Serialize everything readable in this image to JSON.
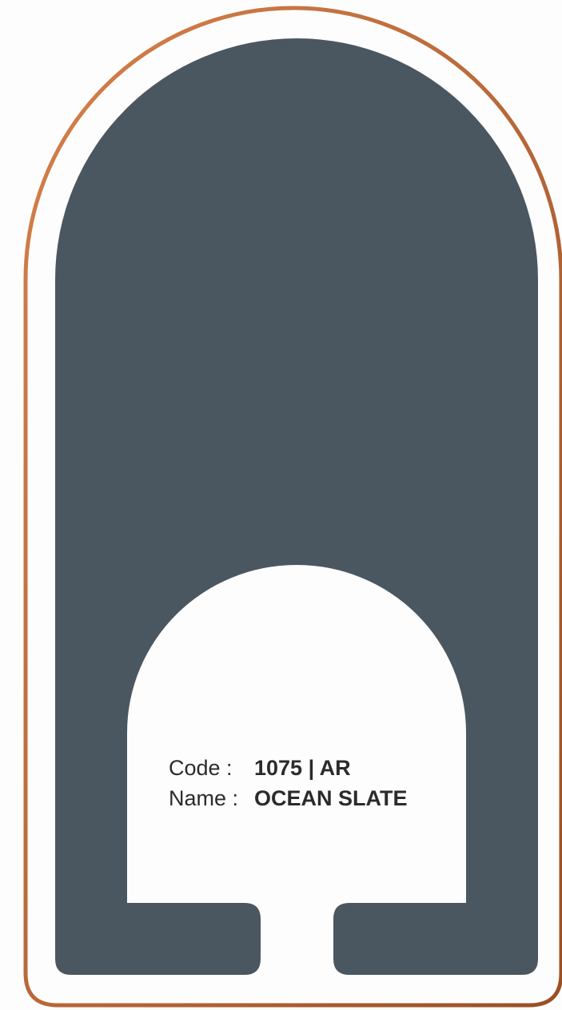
{
  "swatch": {
    "code_label": "Code :",
    "code_value": "1075 | AR",
    "name_label": "Name :",
    "name_value": "OCEAN SLATE",
    "color": "#4b5760",
    "border_color_start": "#d6814c",
    "border_color_end": "#9a4f24"
  }
}
